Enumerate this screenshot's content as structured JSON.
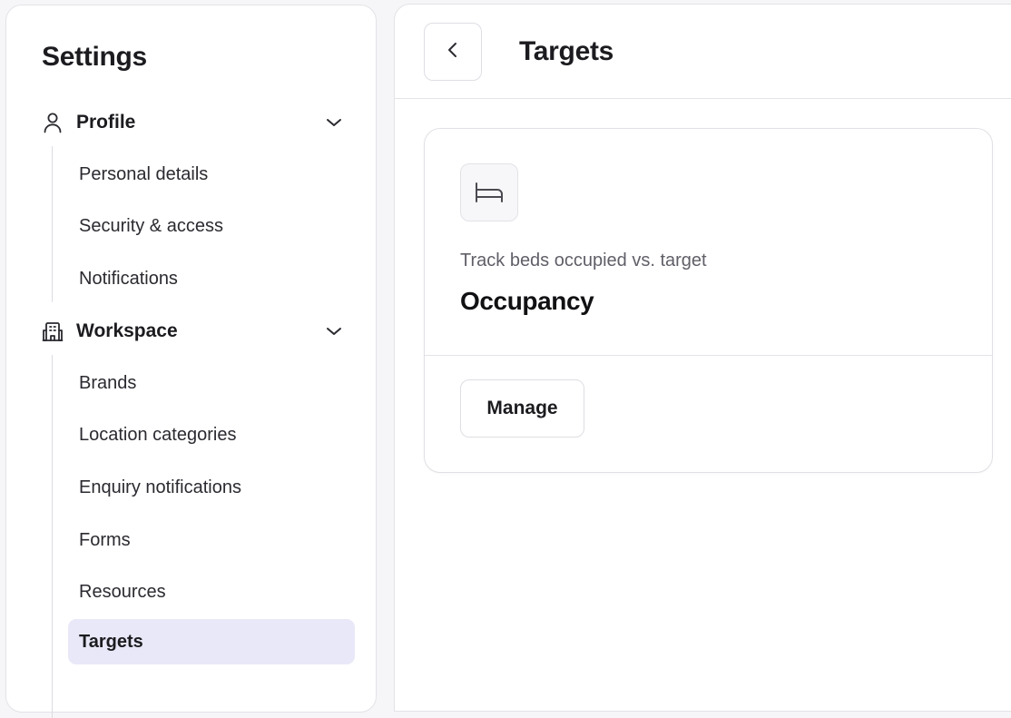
{
  "sidebar": {
    "title": "Settings",
    "groups": [
      {
        "label": "Profile",
        "icon": "user-icon",
        "items": [
          {
            "label": "Personal details"
          },
          {
            "label": "Security & access"
          },
          {
            "label": "Notifications"
          }
        ]
      },
      {
        "label": "Workspace",
        "icon": "building-icon",
        "items": [
          {
            "label": "Brands"
          },
          {
            "label": "Location categories"
          },
          {
            "label": "Enquiry notifications"
          },
          {
            "label": "Forms"
          },
          {
            "label": "Resources"
          },
          {
            "label": "Targets",
            "active": true
          }
        ]
      }
    ]
  },
  "main": {
    "back_icon": "chevron-left-icon",
    "title": "Targets",
    "card": {
      "icon": "bed-icon",
      "subtitle": "Track beds occupied vs. target",
      "title": "Occupancy",
      "button_label": "Manage"
    }
  },
  "colors": {
    "active_item_bg": "#e9e8f8",
    "page_bg": "#f6f6f8",
    "border": "#e3e3e8"
  }
}
